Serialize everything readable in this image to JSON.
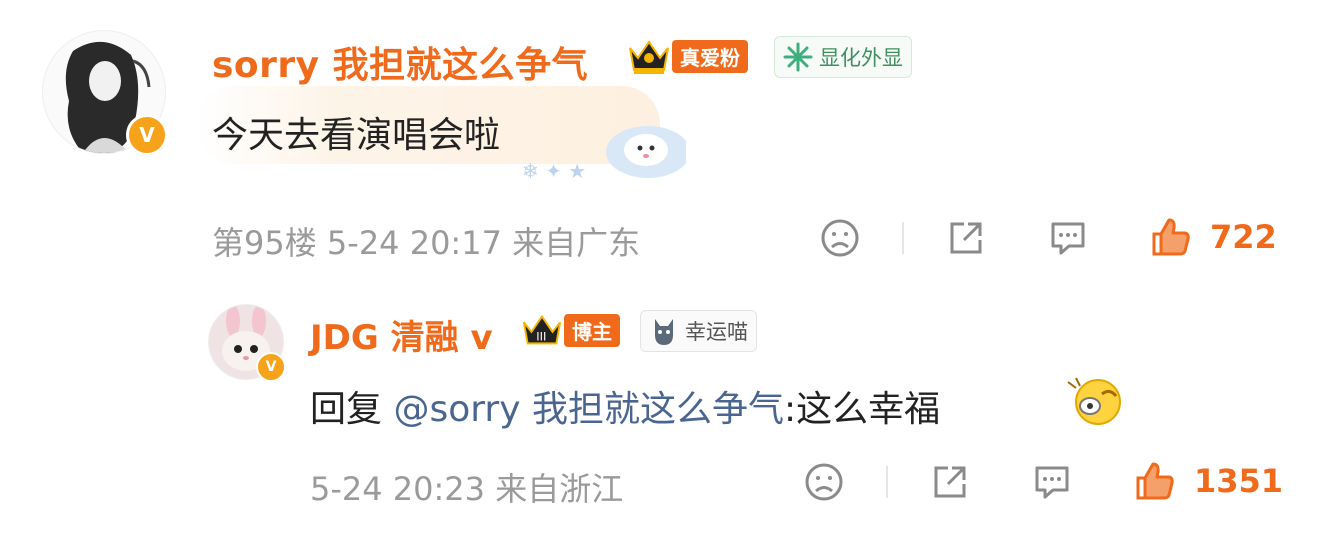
{
  "comments": [
    {
      "username": "sorry 我担就这么争气",
      "role_badge": "真爱粉",
      "extra_badge": "显化外显",
      "text": "今天去看演唱会啦",
      "floor": "第95楼",
      "date": "5-24 20:17",
      "location": "来自广东",
      "likes": "722",
      "verify_mark": "V"
    },
    {
      "username": "JDG 清融 v",
      "role_badge": "博主",
      "extra_badge": "幸运喵",
      "reply_prefix": "回复 ",
      "mention": "@sorry 我担就这么争气",
      "text": ":这么幸福",
      "date": "5-24 20:23",
      "location": "来自浙江",
      "likes": "1351",
      "verify_mark": "V"
    }
  ],
  "colors": {
    "brand": "#f06a1c",
    "mention": "#4a6690",
    "meta": "#9a9a9a",
    "verify": "#f7a21b"
  },
  "icons": [
    "sad-face-icon",
    "share-icon",
    "comment-icon",
    "thumbs-up-icon"
  ]
}
